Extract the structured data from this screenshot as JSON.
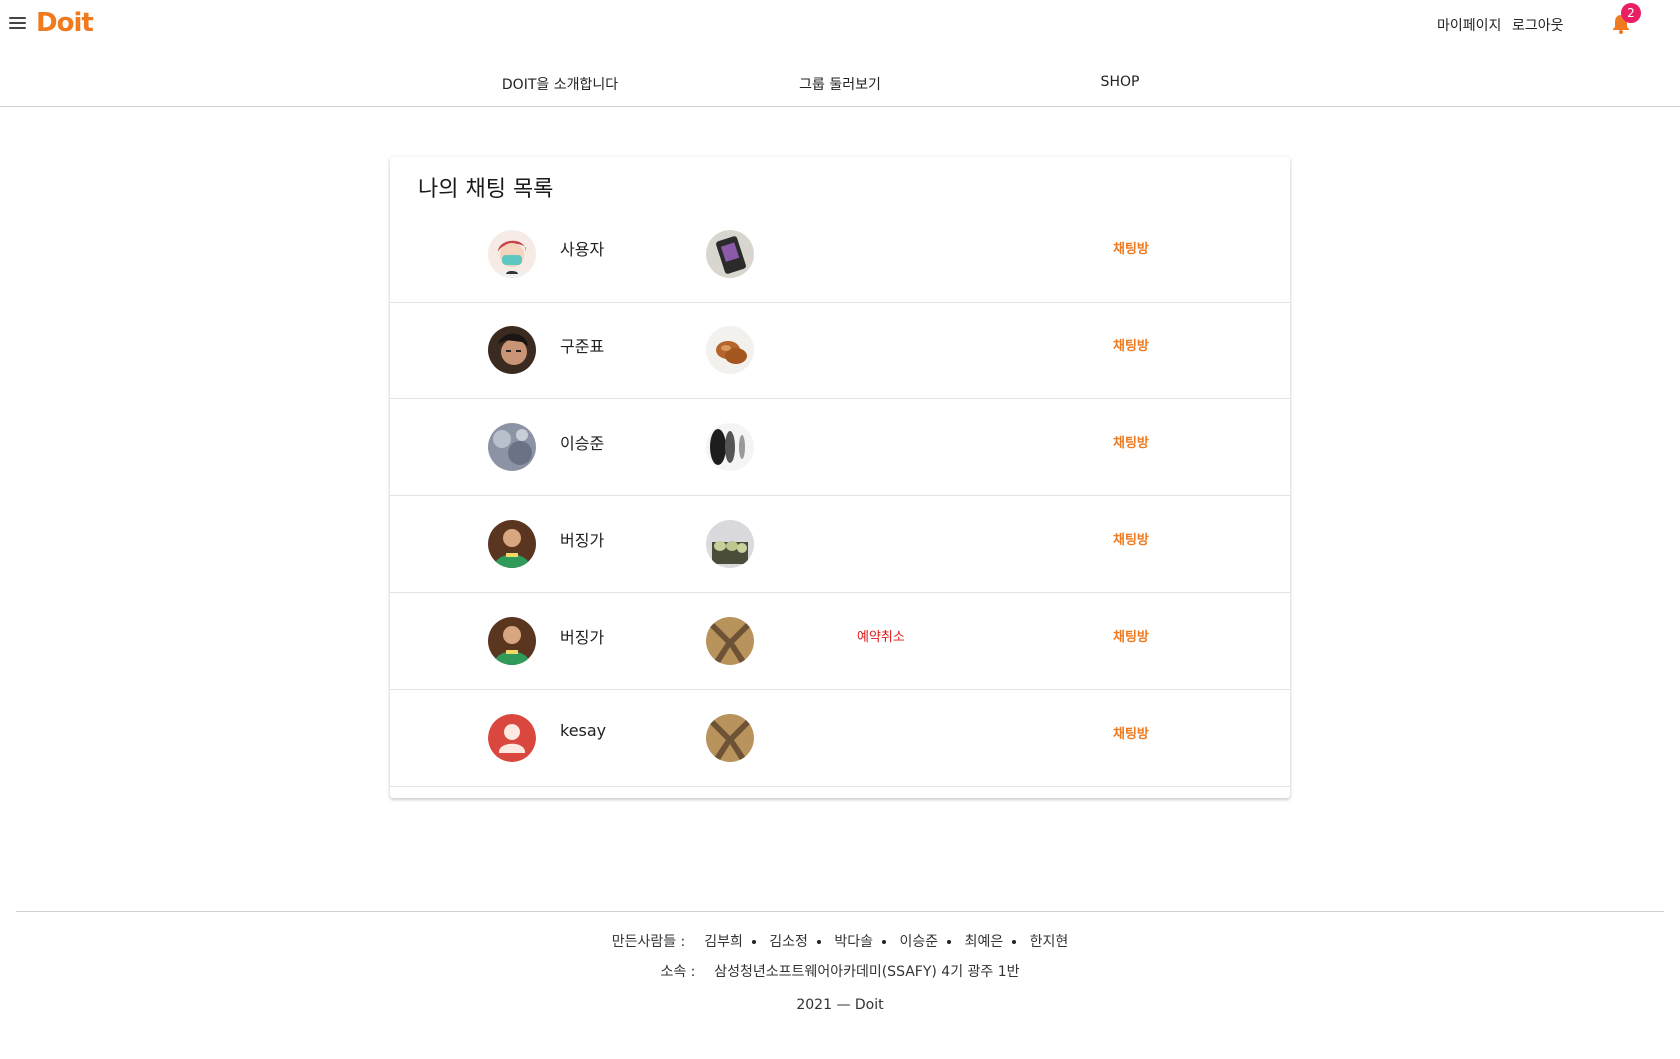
{
  "header": {
    "logo": "Doit",
    "mypage": "마이페이지",
    "logout": "로그아웃",
    "notification_count": "2"
  },
  "nav": {
    "items": [
      "DOIT을 소개합니다",
      "그룹 둘러보기",
      "SHOP"
    ]
  },
  "chat_list": {
    "title": "나의 채팅 목록",
    "rows": [
      {
        "user": "사용자",
        "chat_label": "채팅방",
        "cancel_label": ""
      },
      {
        "user": "구준표",
        "chat_label": "채팅방",
        "cancel_label": ""
      },
      {
        "user": "이승준",
        "chat_label": "채팅방",
        "cancel_label": ""
      },
      {
        "user": "버징가",
        "chat_label": "채팅방",
        "cancel_label": ""
      },
      {
        "user": "버징가",
        "chat_label": "채팅방",
        "cancel_label": "예약취소"
      },
      {
        "user": "kesay",
        "chat_label": "채팅방",
        "cancel_label": ""
      }
    ]
  },
  "footer": {
    "makers_label": "만든사람들 :",
    "makers": [
      "김부희",
      "김소정",
      "박다솔",
      "이승준",
      "최예은",
      "한지현"
    ],
    "org_label": "소속 :",
    "org": "삼성청년소프트웨어아카데미(SSAFY) 4기 광주 1반",
    "copyright": "2021 — Doit"
  },
  "colors": {
    "accent": "#f07a1f",
    "cancel": "#e01919",
    "badge": "#e91e63"
  }
}
